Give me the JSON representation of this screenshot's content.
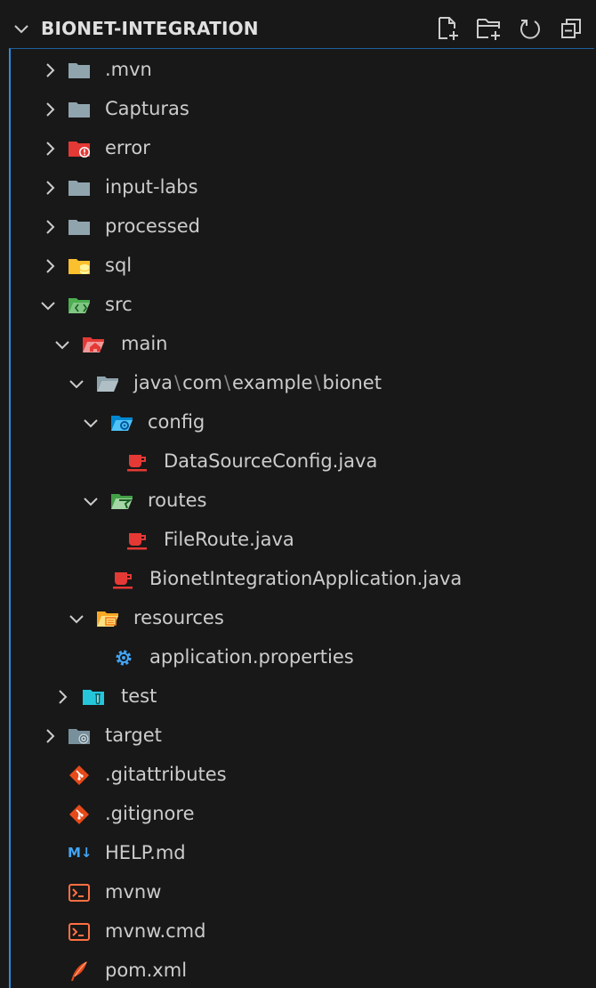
{
  "header": {
    "title": "BIONET-INTEGRATION"
  },
  "tree": {
    "mvn": ".mvn",
    "capturas": "Capturas",
    "error": "error",
    "input_labs": "input-labs",
    "processed": "processed",
    "sql": "sql",
    "src": "src",
    "main": "main",
    "path": {
      "p1": "java",
      "p2": "com",
      "p3": "example",
      "p4": "bionet",
      "sep": "\\"
    },
    "config": "config",
    "datasource": "DataSourceConfig.java",
    "routes": "routes",
    "fileroute": "FileRoute.java",
    "app": "BionetIntegrationApplication.java",
    "resources": "resources",
    "app_props": "application.properties",
    "test": "test",
    "target": "target",
    "gitattributes": ".gitattributes",
    "gitignore": ".gitignore",
    "help_md": "HELP.md",
    "md_icon_text": "M↓",
    "mvnw": "mvnw",
    "mvnw_cmd": "mvnw.cmd",
    "pom": "pom.xml"
  },
  "colors": {
    "accent": "#2f8be0",
    "folder": "#90a4ae",
    "java": "#e53935",
    "git": "#e64a19",
    "sql": "#fbc02d",
    "src": "#4caf50",
    "config": "#29b6f6",
    "test": "#26c6da"
  }
}
